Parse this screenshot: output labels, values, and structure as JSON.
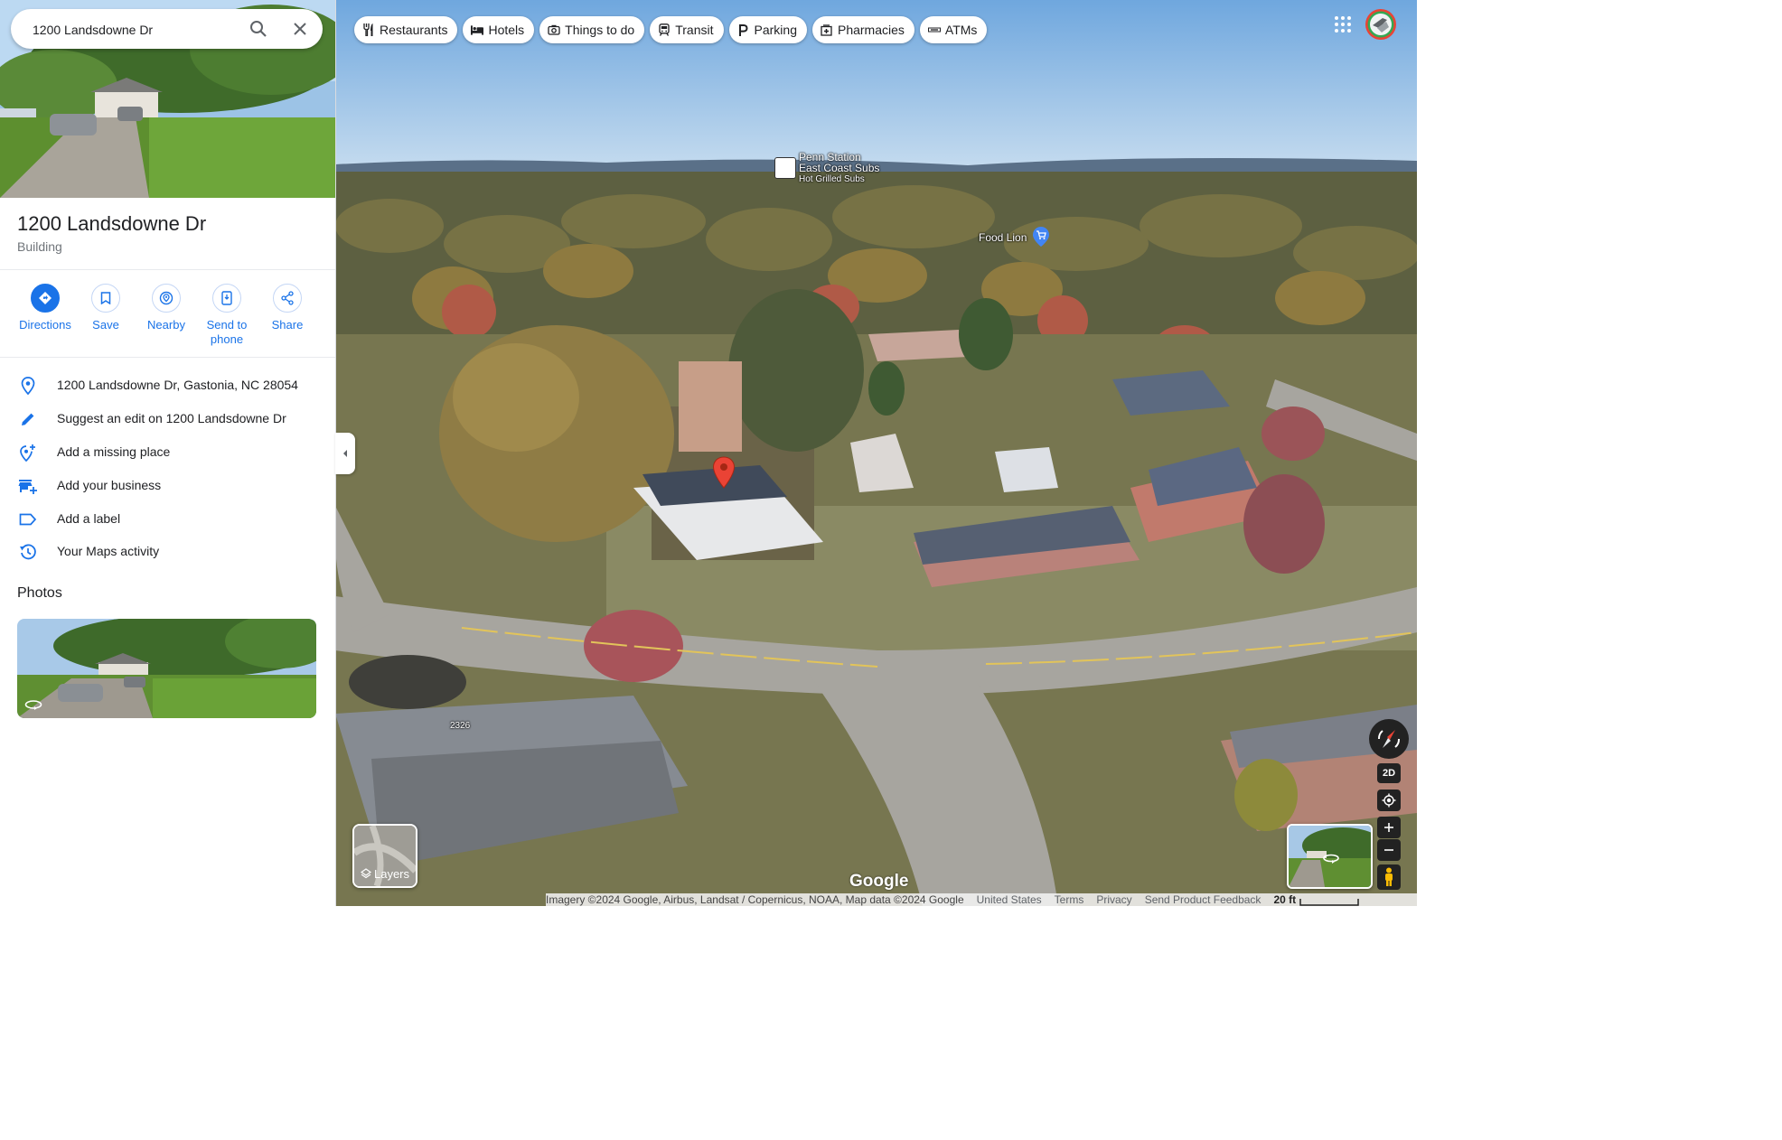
{
  "search": {
    "value": "1200 Landsdowne Dr"
  },
  "place": {
    "title": "1200 Landsdowne Dr",
    "type": "Building"
  },
  "actions": [
    {
      "label": "Directions",
      "icon": "directions-icon"
    },
    {
      "label": "Save",
      "icon": "bookmark-icon"
    },
    {
      "label": "Nearby",
      "icon": "nearby-icon"
    },
    {
      "label": "Send to phone",
      "icon": "send-to-phone-icon"
    },
    {
      "label": "Share",
      "icon": "share-icon"
    }
  ],
  "info": [
    {
      "text": "1200 Landsdowne Dr, Gastonia, NC 28054",
      "icon": "location-pin-icon"
    },
    {
      "text": "Suggest an edit on 1200 Landsdowne Dr",
      "icon": "pencil-icon"
    },
    {
      "text": "Add a missing place",
      "icon": "add-location-icon"
    },
    {
      "text": "Add your business",
      "icon": "add-business-icon"
    },
    {
      "text": "Add a label",
      "icon": "label-icon"
    },
    {
      "text": "Your Maps activity",
      "icon": "history-icon"
    }
  ],
  "photos": {
    "heading": "Photos"
  },
  "chips": [
    {
      "label": "Restaurants",
      "icon": "fork-knife-icon"
    },
    {
      "label": "Hotels",
      "icon": "bed-icon"
    },
    {
      "label": "Things to do",
      "icon": "camera-icon"
    },
    {
      "label": "Transit",
      "icon": "train-icon"
    },
    {
      "label": "Parking",
      "icon": "parking-icon"
    },
    {
      "label": "Pharmacies",
      "icon": "pharmacy-icon"
    },
    {
      "label": "ATMs",
      "icon": "atm-icon"
    }
  ],
  "map_labels": {
    "penn_station_1": "Penn Station",
    "penn_station_2": "East Coast Subs",
    "penn_station_3": "Hot Grilled Subs",
    "food_lion": "Food Lion",
    "street_number": "2326"
  },
  "controls": {
    "layers": "Layers",
    "mode": "2D",
    "logo": "Google"
  },
  "footer": {
    "imagery": "Imagery ©2024 Google, Airbus, Landsat / Copernicus, NOAA, Map data ©2024 Google",
    "country": "United States",
    "terms": "Terms",
    "privacy": "Privacy",
    "feedback": "Send Product Feedback",
    "scale": "20 ft"
  },
  "colors": {
    "accent": "#1a73e8",
    "pin": "#ea4335"
  }
}
